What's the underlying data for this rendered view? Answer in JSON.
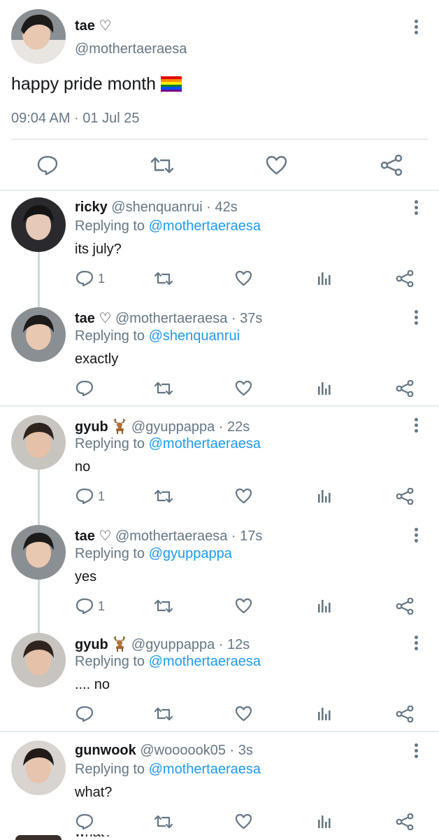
{
  "main_tweet": {
    "name": "tae ♡",
    "handle": "@mothertaeraesa",
    "text": "happy pride month",
    "timestamp": "09:04 AM · 01 Jul 25",
    "emoji": "rainbow-flag-icon"
  },
  "replies": [
    {
      "name": "ricky",
      "handle": "@shenquanrui",
      "time": "· 42s",
      "replying_prefix": "Replying to",
      "replying_to": "@mothertaeraesa",
      "text": "its july?",
      "reply_count": "1"
    },
    {
      "name": "tae ♡",
      "handle": "@mothertaeraesa",
      "time": "· 37s",
      "replying_prefix": "Replying to",
      "replying_to": "@shenquanrui",
      "text": "exactly",
      "reply_count": ""
    },
    {
      "name": "gyub",
      "handle": "@gyuppappa",
      "time": "· 22s",
      "replying_prefix": "Replying to",
      "replying_to": "@mothertaeraesa",
      "text": "no",
      "reply_count": "1"
    },
    {
      "name": "tae ♡",
      "handle": "@mothertaeraesa",
      "time": "· 17s",
      "replying_prefix": "Replying to",
      "replying_to": "@gyuppappa",
      "text": "yes",
      "reply_count": "1"
    },
    {
      "name": "gyub",
      "handle": "@gyuppappa",
      "time": "· 12s",
      "replying_prefix": "Replying to",
      "replying_to": "@mothertaeraesa",
      "text": ".... no",
      "reply_count": ""
    },
    {
      "name": "gunwook",
      "handle": "@woooook05",
      "time": "· 3s",
      "replying_prefix": "Replying to",
      "replying_to": "@mothertaeraesa",
      "text": "what?",
      "reply_count": ""
    }
  ],
  "colors": {
    "link": "#1d9bf0",
    "muted": "#657786",
    "divider": "#e6ecf0",
    "thread_line": "#cfd9de"
  }
}
